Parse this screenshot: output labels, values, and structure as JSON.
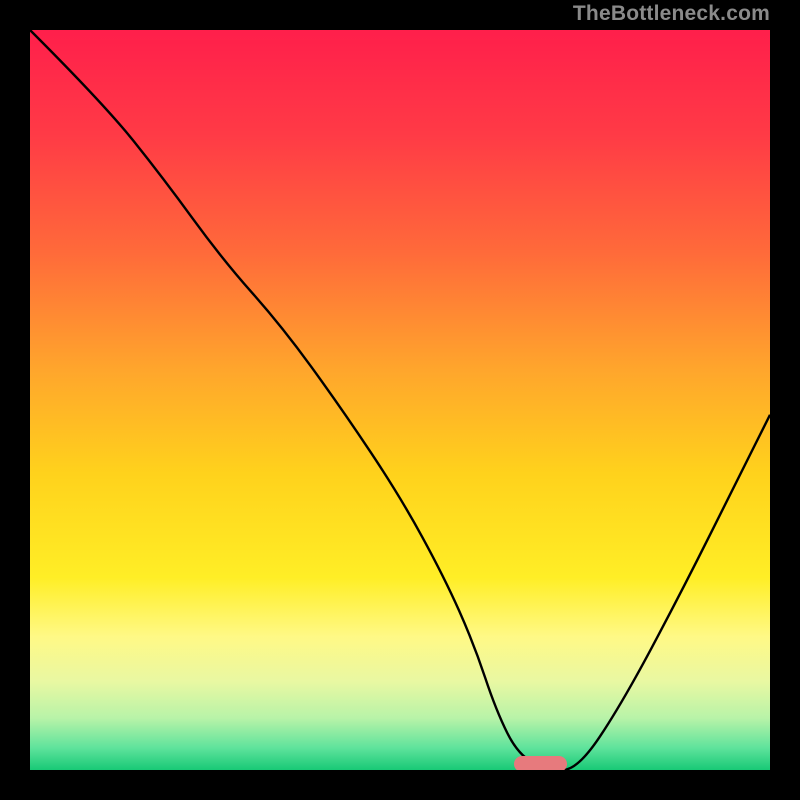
{
  "watermark": "TheBottleneck.com",
  "colors": {
    "gradient_stops": [
      {
        "pct": 0,
        "color": "#ff1f4b"
      },
      {
        "pct": 14,
        "color": "#ff3a46"
      },
      {
        "pct": 30,
        "color": "#ff6a3a"
      },
      {
        "pct": 46,
        "color": "#ffa62c"
      },
      {
        "pct": 60,
        "color": "#ffd21c"
      },
      {
        "pct": 74,
        "color": "#ffee26"
      },
      {
        "pct": 82,
        "color": "#fff986"
      },
      {
        "pct": 88,
        "color": "#e9f8a2"
      },
      {
        "pct": 93,
        "color": "#b8f3a8"
      },
      {
        "pct": 97,
        "color": "#5fe39c"
      },
      {
        "pct": 100,
        "color": "#18c976"
      }
    ],
    "curve": "#000000",
    "marker": "#e77a7d",
    "frame": "#000000"
  },
  "chart_data": {
    "type": "line",
    "title": "",
    "xlabel": "",
    "ylabel": "",
    "xlim": [
      0,
      100
    ],
    "ylim": [
      0,
      100
    ],
    "series": [
      {
        "name": "bottleneck-curve",
        "x": [
          0,
          10,
          18,
          26,
          34,
          42,
          50,
          56,
          60,
          63,
          66,
          70,
          74,
          80,
          88,
          96,
          100
        ],
        "y": [
          100,
          90,
          80,
          69,
          60,
          49,
          37,
          26,
          17,
          8,
          2,
          0,
          0,
          9,
          24,
          40,
          48
        ]
      }
    ],
    "flat_region_x": [
      66,
      72
    ],
    "annotations": []
  }
}
